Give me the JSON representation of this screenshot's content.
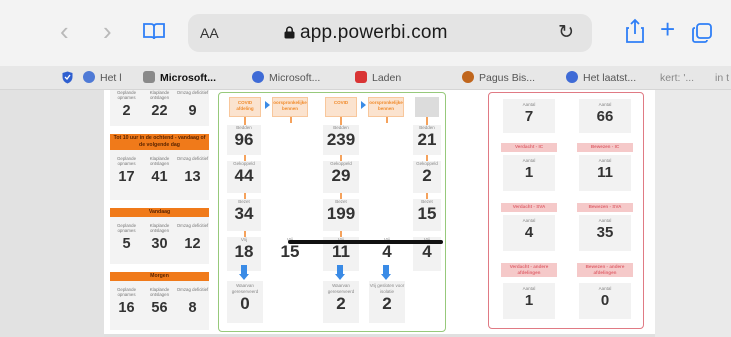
{
  "browser": {
    "url": "app.powerbi.com",
    "text_size_label": "AA",
    "icons": [
      "back-icon",
      "forward-icon",
      "bookmarks-icon",
      "lock-icon",
      "reload-icon",
      "share-icon",
      "new-tab-icon",
      "tabs-icon"
    ]
  },
  "tabs": [
    {
      "label": "Het l",
      "favicon_color": "#4f7ad6"
    },
    {
      "label": "Microsoft...",
      "favicon_color": "#8a8a8a"
    },
    {
      "label": "Microsoft...",
      "favicon_color": "#3f6bd6"
    },
    {
      "label": "Laden",
      "favicon_color": "#d93434"
    },
    {
      "label": "Pagus Bis...",
      "favicon_color": "#c0661d"
    },
    {
      "label": "Het laatst...",
      "favicon_color": "#3f6bd6"
    },
    {
      "label": "kert: '...",
      "favicon_color": ""
    },
    {
      "label": "in t",
      "favicon_color": ""
    }
  ],
  "left_panel": {
    "col_labels": [
      "Geplande opnames",
      "Klaplande ontslagen",
      "Omzag deficitief"
    ],
    "row0": {
      "values": [
        "2",
        "22",
        "9"
      ]
    },
    "block1": {
      "title": "Tot 10 uur in de ochtend - vandaag of de volgende dag",
      "values": [
        "17",
        "41",
        "13"
      ]
    },
    "block2": {
      "title": "Vandaag",
      "values": [
        "5",
        "30",
        "12"
      ]
    },
    "block3": {
      "title": "Morgen",
      "values": [
        "16",
        "56",
        "8"
      ]
    }
  },
  "flow": {
    "col1": {
      "header": "COVID afdeling",
      "arrow_label": "oorspronkelijke bennen",
      "bedden": "96",
      "gekoppeld": "44",
      "bezet": "34",
      "vrij": "18",
      "bottom_label": "Waarvan gereserveerd",
      "bottom": "0"
    },
    "col2": {
      "vrij": "15"
    },
    "col3": {
      "header": "COVID",
      "arrow_label": "oorspronkelijke bennen",
      "bedden": "239",
      "gekoppeld": "29",
      "bezet": "199",
      "vrij": "11",
      "bottom_label": "Waarvan gereserveerd",
      "bottom": "2"
    },
    "col4": {
      "vrij": "4",
      "bottom_label": "Vrij gesloten voor isolatie",
      "bottom": "2"
    },
    "col5": {
      "bedden": "21",
      "gekoppeld": "2",
      "bezet": "15",
      "vrij": "4"
    },
    "labels": {
      "bedden": "Bedden",
      "gekoppeld": "Gekoppeld",
      "bezet": "Bezet",
      "vrij": "Vrij"
    }
  },
  "right_panel": {
    "aantal_label": "Aantal",
    "rows": [
      {
        "left_title": "",
        "left": "7",
        "right_title": "",
        "right": "66"
      },
      {
        "left_title": "Verdacht - IC",
        "left": "1",
        "right_title": "Bewezen - IC",
        "right": "11"
      },
      {
        "left_title": "Verdacht - SVA",
        "left": "4",
        "right_title": "Bewezen - SVA",
        "right": "35"
      },
      {
        "left_title": "Verdacht - andere afdelingen",
        "left": "1",
        "right_title": "Bewezen - andere afdelingen",
        "right": "0"
      }
    ]
  },
  "colors": {
    "accent_orange": "#f07a1a",
    "green_border": "#97c97b",
    "red_border": "#e07a84",
    "link_blue": "#2f7ff6"
  }
}
